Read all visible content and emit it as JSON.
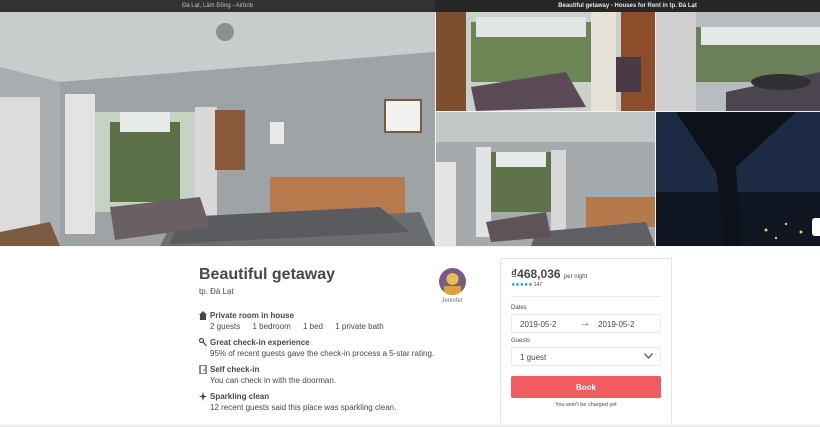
{
  "windows": {
    "left_title": "Đà Lạt, Lâm Đồng - Airbnb",
    "right_title": "Beautiful getaway - Houses for Rent in tp. Đà Lạt"
  },
  "listing": {
    "title": "Beautiful getaway",
    "location": "tp. Đà Lạt",
    "host_name": "Jennifer",
    "features": [
      {
        "icon": "house-icon",
        "heading": "Private room in house",
        "stats": [
          "2 guests",
          "1 bedroom",
          "1 bed",
          "1 private bath"
        ]
      },
      {
        "icon": "key-icon",
        "heading": "Great check-in experience",
        "detail": "95% of recent guests gave the check-in process a 5-star rating."
      },
      {
        "icon": "door-icon",
        "heading": "Self check-in",
        "detail": "You can check in with the doorman."
      },
      {
        "icon": "sparkle-icon",
        "heading": "Sparkling clean",
        "detail": "12 recent guests said this place was sparkling clean."
      }
    ]
  },
  "booking": {
    "price": "₫468,036",
    "per_night": "per night",
    "stars": "★★★★★",
    "rating_count": "147",
    "dates_label": "Dates",
    "check_in": "2019-05-2",
    "check_out": "2019-05-2",
    "guests_label": "Guests",
    "guests_value": "1 guest",
    "book_label": "Book",
    "note": "You won't be charged yet"
  },
  "colors": {
    "brand": "#f25b5f",
    "rating": "#008489",
    "text": "#484848"
  }
}
